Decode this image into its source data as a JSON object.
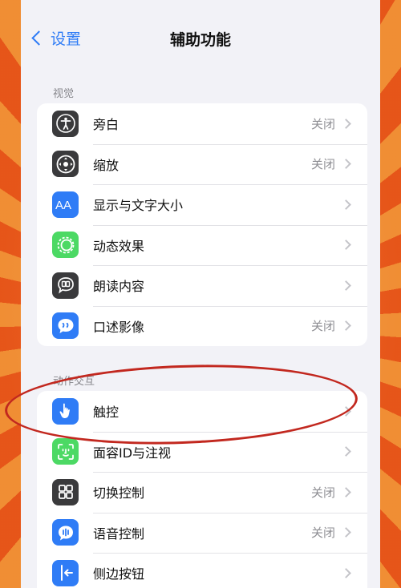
{
  "nav": {
    "back_label": "设置",
    "title": "辅助功能"
  },
  "sections": [
    {
      "header": "视觉",
      "rows": [
        {
          "icon": "accessibility-person-icon",
          "color": "#3a3a3c",
          "label": "旁白",
          "value": "关闭"
        },
        {
          "icon": "zoom-icon",
          "color": "#3a3a3c",
          "label": "缩放",
          "value": "关闭"
        },
        {
          "icon": "text-size-icon",
          "color": "#2f7cf6",
          "label": "显示与文字大小",
          "value": ""
        },
        {
          "icon": "motion-icon",
          "color": "#4cd964",
          "label": "动态效果",
          "value": ""
        },
        {
          "icon": "spoken-content-icon",
          "color": "#3a3a3c",
          "label": "朗读内容",
          "value": ""
        },
        {
          "icon": "audio-descriptions-icon",
          "color": "#2f7cf6",
          "label": "口述影像",
          "value": "关闭"
        }
      ]
    },
    {
      "header": "动作交互",
      "rows": [
        {
          "icon": "touch-hand-icon",
          "color": "#2f7cf6",
          "label": "触控",
          "value": ""
        },
        {
          "icon": "face-id-icon",
          "color": "#4cd964",
          "label": "面容ID与注视",
          "value": ""
        },
        {
          "icon": "switch-control-icon",
          "color": "#3a3a3c",
          "label": "切换控制",
          "value": "关闭"
        },
        {
          "icon": "voice-control-icon",
          "color": "#2f7cf6",
          "label": "语音控制",
          "value": "关闭"
        },
        {
          "icon": "side-button-icon",
          "color": "#2f7cf6",
          "label": "侧边按钮",
          "value": ""
        }
      ]
    }
  ],
  "annotation": {
    "highlight_color": "#c2281f"
  }
}
